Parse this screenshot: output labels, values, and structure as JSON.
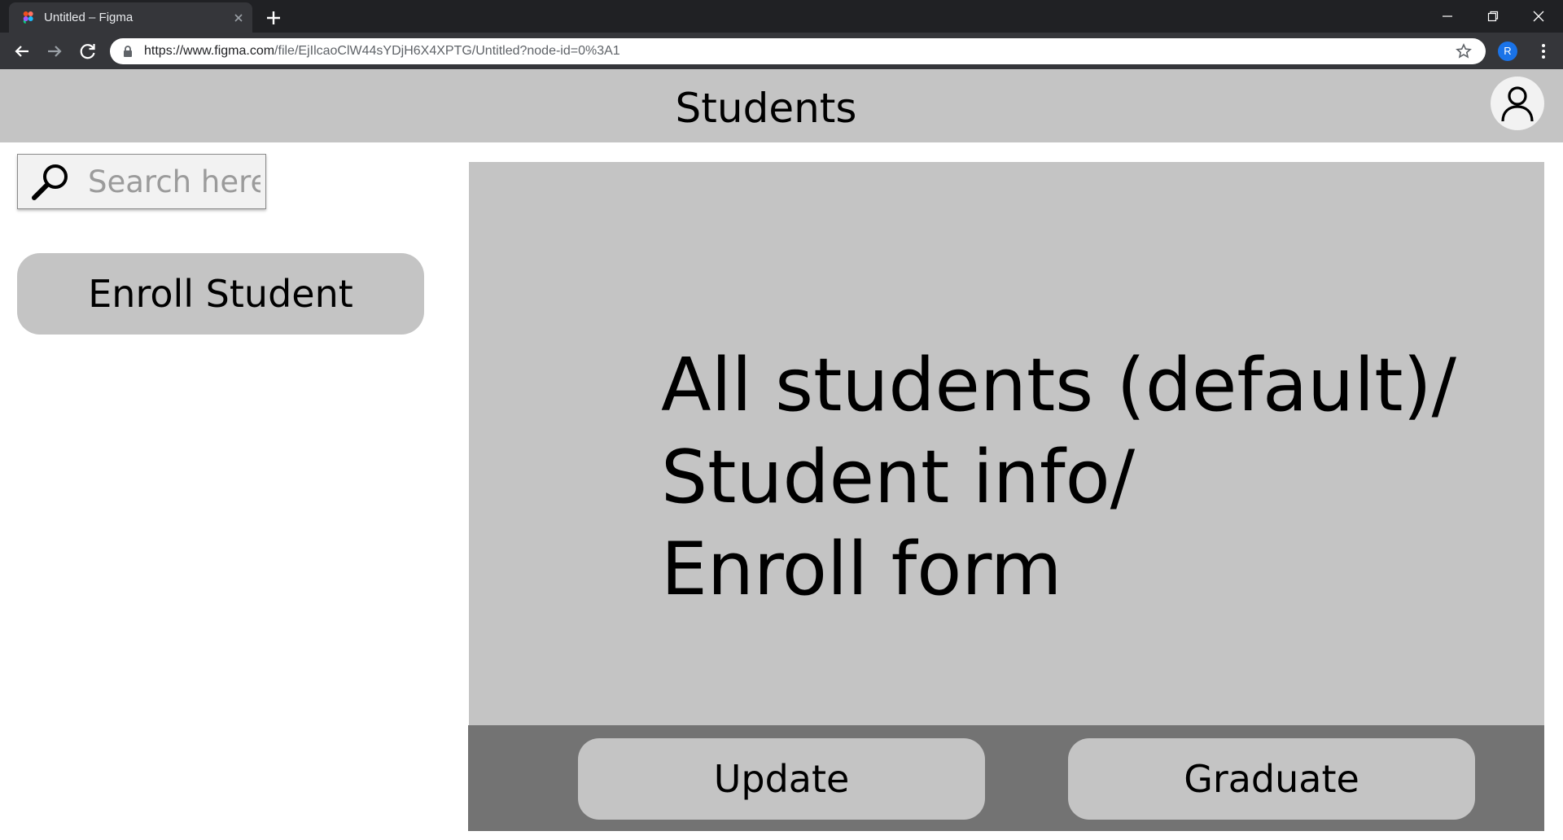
{
  "browser": {
    "tab_title": "Untitled – Figma",
    "url_host": "https://www.figma.com",
    "url_path": "/file/EjIlcaoClW44sYDjH6X4XPTG/Untitled?node-id=0%3A1",
    "profile_initial": "R"
  },
  "header": {
    "title": "Students"
  },
  "sidebar": {
    "search_placeholder": "Search here",
    "enroll_label": "Enroll Student"
  },
  "main": {
    "placeholder_lines": [
      "All students (default)/",
      "Student info/",
      "Enroll form"
    ]
  },
  "actions": {
    "update_label": "Update",
    "graduate_label": "Graduate"
  },
  "colors": {
    "header_bg": "#c4c4c4",
    "panel_bg": "#c4c4c4",
    "action_bar_bg": "#737373",
    "button_bg": "#c4c4c4"
  }
}
